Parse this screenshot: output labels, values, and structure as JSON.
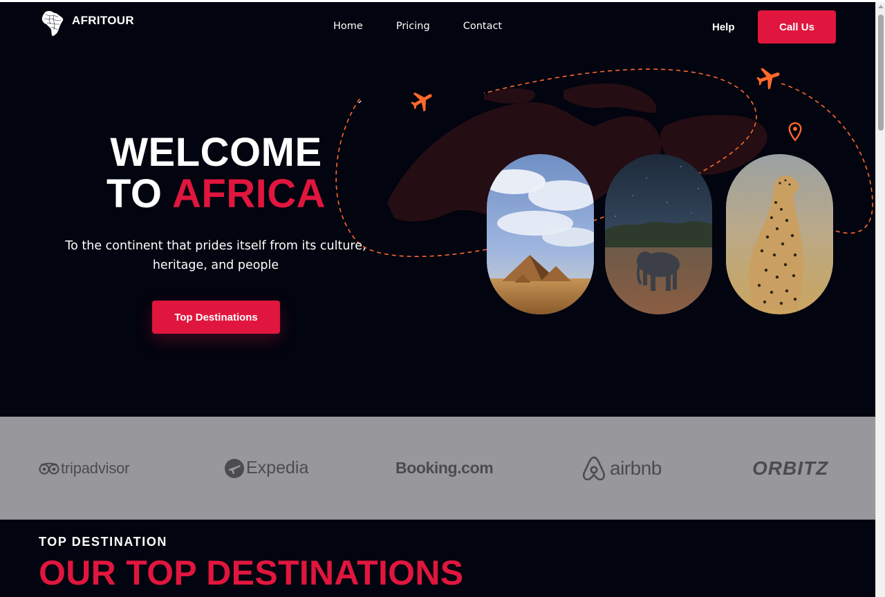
{
  "brand": {
    "name": "AFRITOUR",
    "logo_icon": "africa-map-icon"
  },
  "nav": {
    "links": [
      "Home",
      "Pricing",
      "Contact"
    ],
    "help_label": "Help",
    "cta_label": "Call Us"
  },
  "hero": {
    "title_line1": "WELCOME",
    "title_line2_a": "TO",
    "title_line2_b": "AFRICA",
    "subtitle": "To the continent that prides itself from its culture, heritage, and people",
    "button_label": "Top Destinations",
    "images": [
      "pyramids-photo",
      "elephant-photo",
      "cheetah-photo"
    ],
    "decor_icons": [
      "airplane-icon",
      "airplane-icon",
      "location-pin-icon"
    ]
  },
  "partners": [
    "tripadvisor",
    "Expedia",
    "Booking.com",
    "airbnb",
    "ORBITZ"
  ],
  "destinations": {
    "kicker": "TOP DESTINATION",
    "title": "OUR TOP DESTINATIONS"
  },
  "colors": {
    "background": "#02040f",
    "accent": "#e0163e",
    "dash": "#ff6a2b",
    "partner_band": "#98989c"
  }
}
